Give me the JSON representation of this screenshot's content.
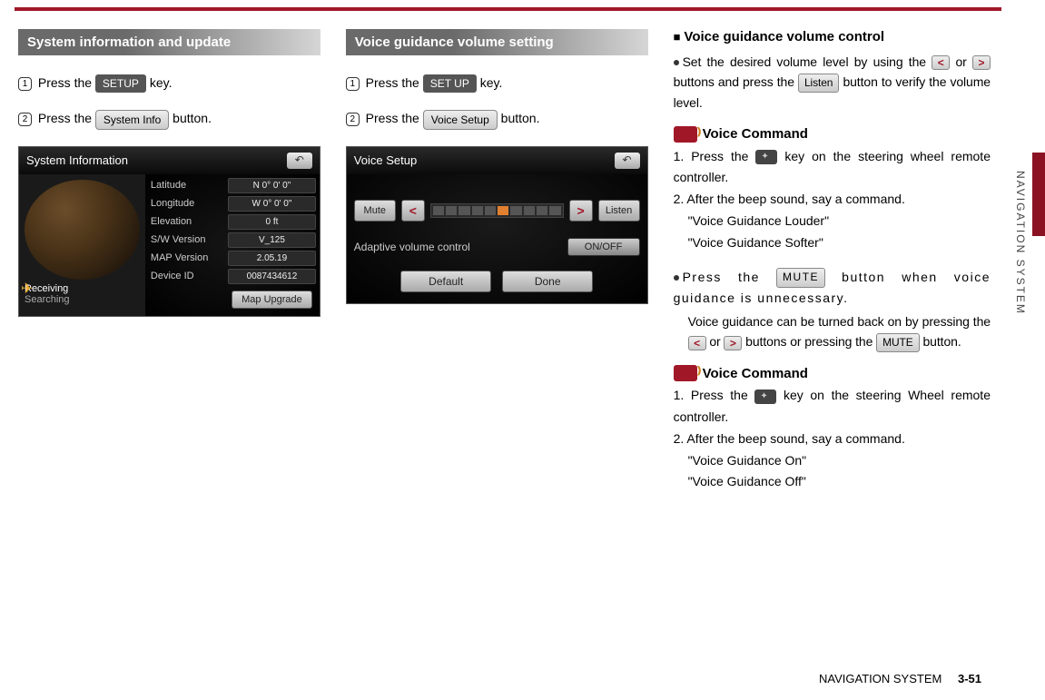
{
  "col1": {
    "header": "System information and update",
    "step1_a": "Press the ",
    "step1_key": "SETUP",
    "step1_b": " key.",
    "step2_a": "Press the ",
    "step2_btn": "System Info",
    "step2_b": " button.",
    "sysinfo": {
      "title": "System Information",
      "rows": [
        {
          "label": "Latitude",
          "value": "N  0° 0' 0\""
        },
        {
          "label": "Longitude",
          "value": "W  0° 0' 0\""
        },
        {
          "label": "Elevation",
          "value": "0 ft"
        },
        {
          "label": "S/W Version",
          "value": "V_125"
        },
        {
          "label": "MAP Version",
          "value": "2.05.19"
        },
        {
          "label": "Device ID",
          "value": "0087434612"
        }
      ],
      "receiving": "Receiving",
      "searching": "Searching",
      "map_upgrade": "Map Upgrade"
    }
  },
  "col2": {
    "header": "Voice guidance volume setting",
    "step1_a": "Press the ",
    "step1_key": "SET UP",
    "step1_b": " key.",
    "step2_a": "Press the ",
    "step2_btn": "Voice Setup",
    "step2_b": " button.",
    "voice": {
      "title": "Voice Setup",
      "mute": "Mute",
      "listen": "Listen",
      "adaptive": "Adaptive volume control",
      "onoff": "ON/OFF",
      "default": "Default",
      "done": "Done"
    }
  },
  "col3": {
    "h1": "Voice guidance volume control",
    "p1a": "Set the desired volume level by using the ",
    "p1b": " or ",
    "p1c": " buttons and press the ",
    "listen": "Listen",
    "p1d": " button to verify the volume level.",
    "vc_title": "Voice Command",
    "vc1_l1a": "1. Press the ",
    "vc1_l1b": " key on the steering wheel remote controller.",
    "vc1_l2": "2. After the beep sound, say a command.",
    "vc1_q1": "\"Voice Guidance Louder\"",
    "vc1_q2": "\"Voice Guidance Softer\"",
    "p2a": "Press the ",
    "mute": "MUTE",
    "p2b": " button when voice guidance is unnecessary.",
    "p2c": "Voice guidance can be turned back on by pressing the ",
    "p2d": " or ",
    "p2e": " buttons or pressing the ",
    "p2f": " button.",
    "vc2_l1a": "1. Press the ",
    "vc2_l1b": " key on the steering Wheel remote controller.",
    "vc2_l2": "2. After the beep sound, say a command.",
    "vc2_q1": "\"Voice Guidance On\"",
    "vc2_q2": "\"Voice Guidance Off\""
  },
  "side_label": "NAVIGATION SYSTEM",
  "footer_text": "NAVIGATION SYSTEM",
  "page_num": "3-51"
}
